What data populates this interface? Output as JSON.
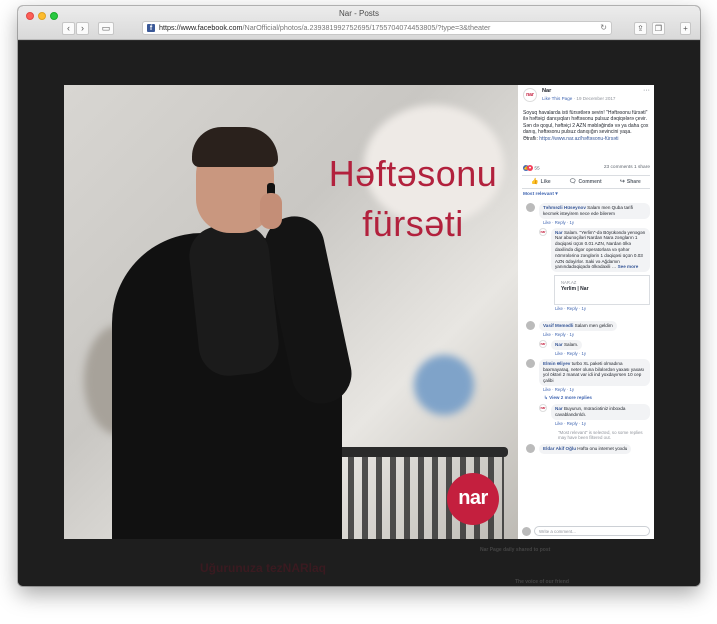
{
  "window": {
    "title": "Nar - Posts",
    "url_host": "https://www.facebook.com",
    "url_path": "/NarOfficial/photos/a.239381992752695/1755704074453805/?type=3&theater"
  },
  "background": {
    "bottom_left_text": "Uğurunuza tezNARlaq",
    "bottom_right_text_1": "Nar Page daily shared to post",
    "bottom_right_text_2": "The voice of our friend"
  },
  "photo": {
    "headline_line1": "Həftəsonu",
    "headline_line2": "fürsəti",
    "logo_text": "nar"
  },
  "post": {
    "page_name": "Nar",
    "like_page": "Like This Page",
    "date": "19 December 2017",
    "text": "Soyuq havalarda isti fürsətlərə sevin! \"Həftəsonu fürsəti\" ilə həftəiçi danışıqları həftəsonu pulsuz dəqiqələrə çevir. Sən də qoşul, həftəiçi 2 AZN məbləğində və ya daha çox danış, həftəsonu pulsuz danışığın sevincini yaşa.",
    "details_label": "Ətraflı:",
    "link": "https://www.nar.az/həftəsonu-fürsəti",
    "reactions_count": "55",
    "comments_shares": "23 comments 1 share",
    "actions": {
      "like": "Like",
      "comment": "Comment",
      "share": "Share"
    },
    "sort_label": "Most relevant ▾"
  },
  "comments": [
    {
      "author": "Təhməzli Hüseynov",
      "text": "Salam men Quba tarifi kecmek isteyirem nece ede bilerem",
      "actions": "Like · Reply · 1y",
      "reply": false
    },
    {
      "author": "Nar",
      "text": "Salam. \"Yerlim\"-də Böyükəndə yenəgən Nar abunəçiləri Nardan Nara zəngların 1 dəqiqəsi üçün 0.01 AZN, Nardan ölkə daxilində digər operatorlara və şəhər nömrələrinə zənglərin 1 dəqiqəsi üçün 0.03 AZN ödəyirlər. Saki və Ağdamın yanındadəqiqədə ölkədaxili …",
      "see_more": "See more",
      "actions": "Like · Reply · 1y",
      "reply": true
    },
    {
      "author": "Vasif Məmədli",
      "text": "Salam men geldim",
      "actions": "Like · Reply · 1y",
      "reply": false
    },
    {
      "author": "Nar",
      "text": "Salam.",
      "actions": "Like · Reply · 1y",
      "reply": true
    },
    {
      "author": "Elmin Əliyev",
      "text": "turbo XL paketi olmadına baxmayaraq, neter oluna bilələrdən yaxası yaxası yol öktəri 2 manat var idi ind yoxdayırsen 10 cep çalibi",
      "actions": "Like · Reply · 1y",
      "reply": false
    },
    {
      "author": "Nar",
      "text": "Buyurun, müraciətiniz inboxda cavablandırıldı.",
      "actions": "Like · Reply · 1y",
      "reply": true
    },
    {
      "author": "Eldar Akif Oğlu",
      "text": "Həftə onu internet yoxdu",
      "actions": "",
      "reply": false
    }
  ],
  "link_card": {
    "source": "NAR.AZ",
    "title": "Yerlim | Nar"
  },
  "view_more_replies": "↳ View 2 more replies",
  "filter_notice": "\"Most relevant\" is selected, so some replies may have been filtered out.",
  "write_placeholder": "Write a comment..."
}
